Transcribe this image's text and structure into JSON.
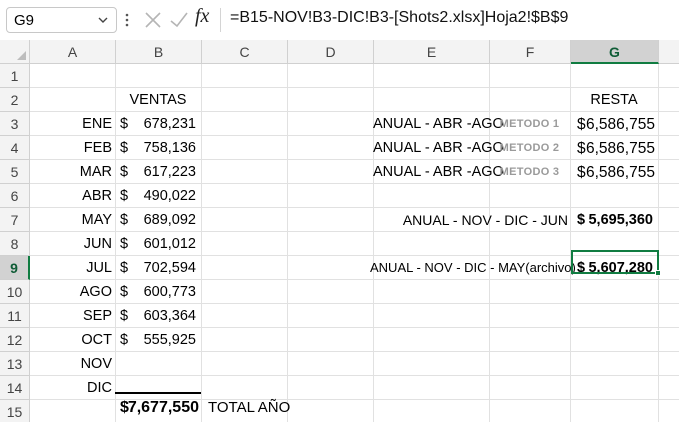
{
  "formula_bar": {
    "name_box": "G9",
    "fx_label": "fx",
    "formula": "=B15-NOV!B3-DIC!B3-[Shots2.xlsx]Hoja2!$B$9"
  },
  "selected_cell": "G9",
  "colors": {
    "selection": "#107c41",
    "header_bg": "#f3f3f3",
    "gridline": "#e1e1e1",
    "metodo_label": "#9a9a9a"
  },
  "columns": [
    "A",
    "B",
    "C",
    "D",
    "E",
    "F",
    "G"
  ],
  "rows": [
    "1",
    "2",
    "3",
    "4",
    "5",
    "6",
    "7",
    "8",
    "9",
    "10",
    "11",
    "12",
    "13",
    "14",
    "15"
  ],
  "sheet": {
    "b2": "VENTAS",
    "g2": "RESTA",
    "currency": "$",
    "months": [
      {
        "m": "ENE",
        "v": "678,231"
      },
      {
        "m": "FEB",
        "v": "758,136"
      },
      {
        "m": "MAR",
        "v": "617,223"
      },
      {
        "m": "ABR",
        "v": "490,022"
      },
      {
        "m": "MAY",
        "v": "689,092"
      },
      {
        "m": "JUN",
        "v": "601,012"
      },
      {
        "m": "JUL",
        "v": "702,594"
      },
      {
        "m": "AGO",
        "v": "600,773"
      },
      {
        "m": "SEP",
        "v": "603,364"
      },
      {
        "m": "OCT",
        "v": "555,925"
      },
      {
        "m": "NOV",
        "v": ""
      },
      {
        "m": "DIC",
        "v": ""
      }
    ],
    "methods": [
      {
        "label": "ANUAL - ABR -AGO",
        "metodo": "METODO 1",
        "value": "6,586,755"
      },
      {
        "label": "ANUAL - ABR -AGO",
        "metodo": "METODO 2",
        "value": "6,586,755"
      },
      {
        "label": "ANUAL - ABR -AGO",
        "metodo": "METODO 3",
        "value": "6,586,755"
      }
    ],
    "e7": "ANUAL - NOV - DIC - JUN",
    "g7": "5,695,360",
    "e9": "ANUAL - NOV - DIC - MAY(archivo)",
    "g9": "5,607,280",
    "b15": "7,677,550",
    "c15": "TOTAL AÑO"
  }
}
